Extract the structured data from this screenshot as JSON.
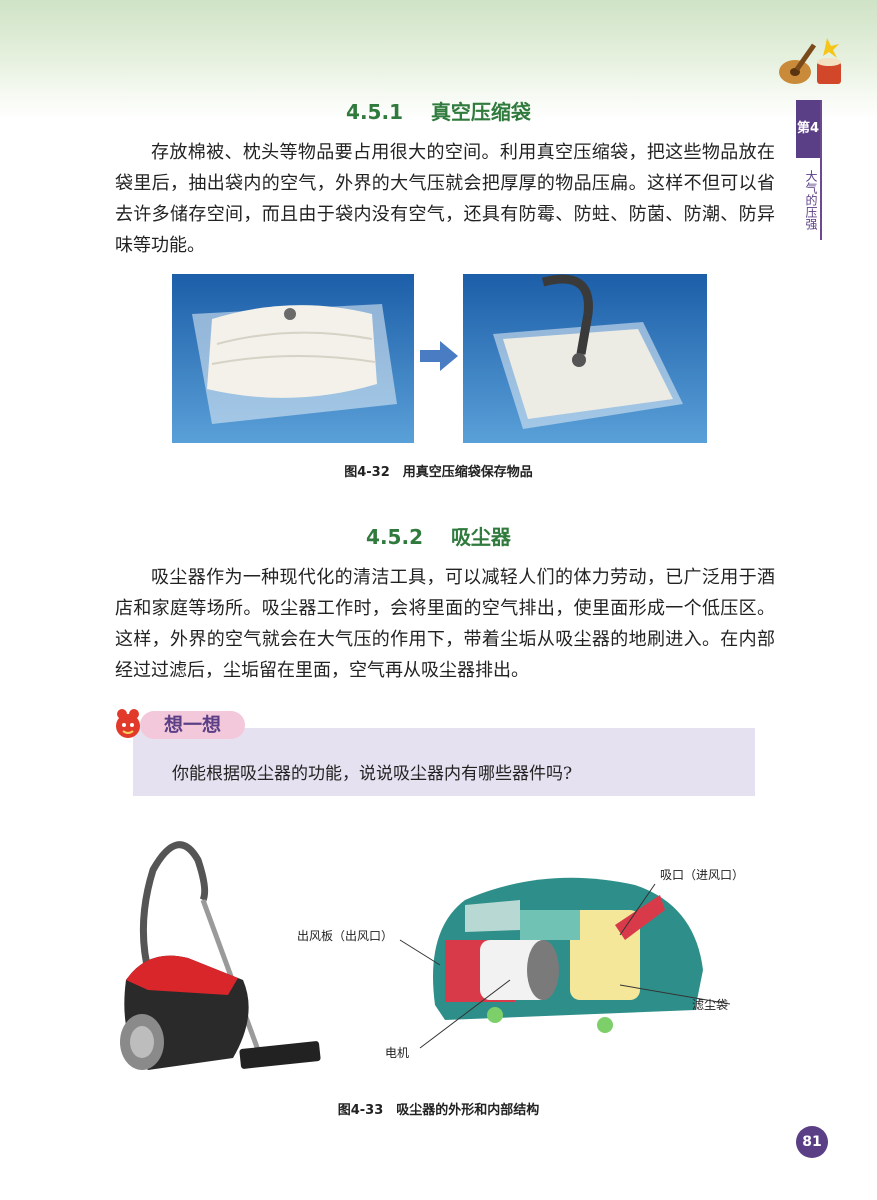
{
  "section1": {
    "number": "4.5.1",
    "title": "真空压缩袋",
    "paragraph": "存放棉被、枕头等物品要占用很大的空间。利用真空压缩袋，把这些物品放在袋里后，抽出袋内的空气，外界的大气压就会把厚厚的物品压扁。这样不但可以省去许多储存空间，而且由于袋内没有空气，还具有防霉、防蛀、防菌、防潮、防异味等功能。",
    "figure_caption": "图4-32　用真空压缩袋保存物品"
  },
  "section2": {
    "number": "4.5.2",
    "title": "吸尘器",
    "paragraph": "吸尘器作为一种现代化的清洁工具，可以减轻人们的体力劳动，已广泛用于酒店和家庭等场所。吸尘器工作时，会将里面的空气排出，使里面形成一个低压区。这样，外界的空气就会在大气压的作用下，带着尘垢从吸尘器的地刷进入。在内部经过过滤后，尘垢留在里面，空气再从吸尘器排出。"
  },
  "think": {
    "tag": "想一想",
    "question": "你能根据吸尘器的功能，说说吸尘器内有哪些器件吗?"
  },
  "figure2": {
    "labels": {
      "intake": "吸口（进风口）",
      "exhaust": "出风板（出风口）",
      "filter_bag": "滤尘袋",
      "motor": "电机"
    },
    "caption": "图4-33　吸尘器的外形和内部结构"
  },
  "side_tab": {
    "chapter": "第4章",
    "title": "大气的压强"
  },
  "page_number": "81",
  "colors": {
    "heading_green": "#2f7a3c",
    "accent_purple": "#5b3f86",
    "think_bg": "#e6e1f0",
    "photo_blue": "#2f6fb5"
  }
}
